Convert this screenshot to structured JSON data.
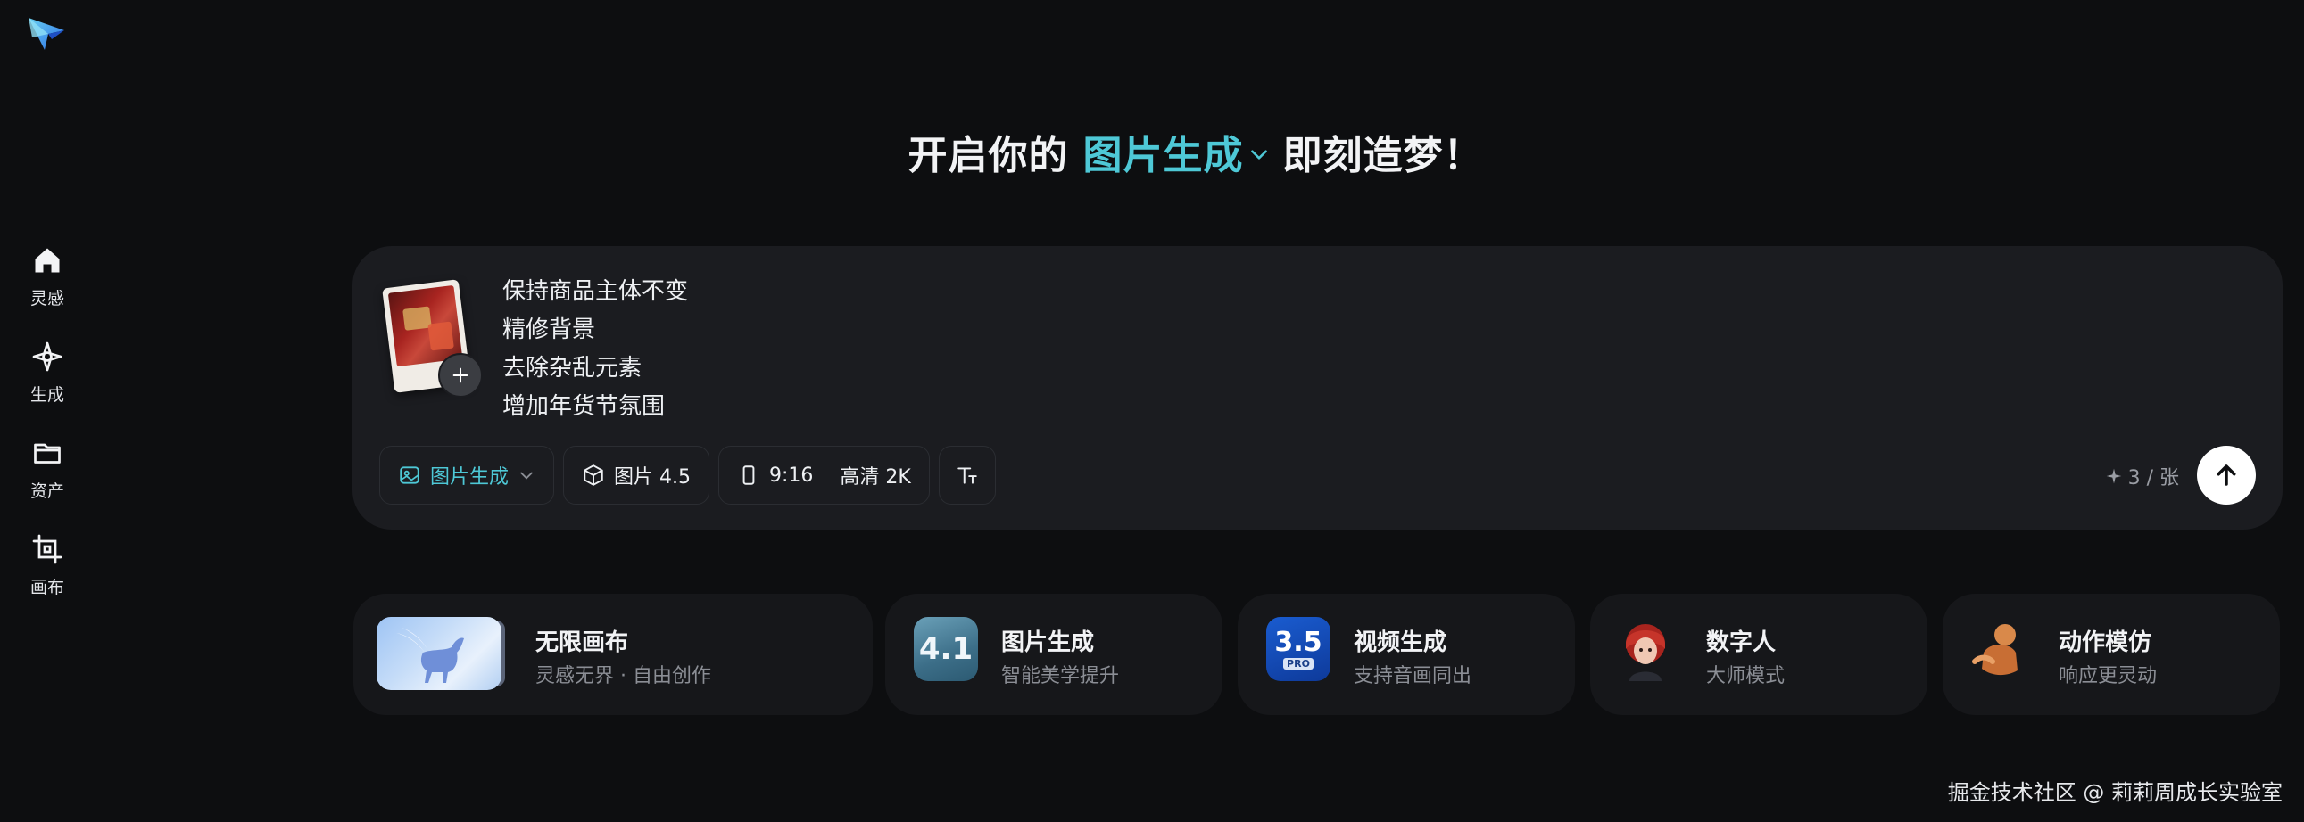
{
  "headline": {
    "prefix": "开启你的",
    "mode": "图片生成",
    "suffix": "即刻造梦！"
  },
  "sidebar": {
    "items": [
      {
        "label": "灵感",
        "icon": "home-icon"
      },
      {
        "label": "生成",
        "icon": "sparkle-icon"
      },
      {
        "label": "资产",
        "icon": "folder-icon"
      },
      {
        "label": "画布",
        "icon": "crop-icon"
      }
    ]
  },
  "prompt": {
    "lines": [
      "保持商品主体不变",
      "精修背景",
      "去除杂乱元素",
      "增加年货节氛围"
    ]
  },
  "toolbar": {
    "mode_label": "图片生成",
    "model_label": "图片 4.5",
    "ratio_label": "9:16",
    "quality_label": "高清 2K",
    "credits": "3 / 张"
  },
  "cards": [
    {
      "title": "无限画布",
      "sub": "灵感无界 · 自由创作"
    },
    {
      "title": "图片生成",
      "sub": "智能美学提升",
      "badge": "4.1"
    },
    {
      "title": "视频生成",
      "sub": "支持音画同出",
      "badge": "3.5",
      "badge_sub": "PRO"
    },
    {
      "title": "数字人",
      "sub": "大师模式"
    },
    {
      "title": "动作模仿",
      "sub": "响应更灵动"
    }
  ],
  "footer": "掘金技术社区 @ 莉莉周成长实验室",
  "colors": {
    "accent": "#4ec8d6",
    "background": "#0d0e10",
    "panel": "#1b1c20"
  }
}
